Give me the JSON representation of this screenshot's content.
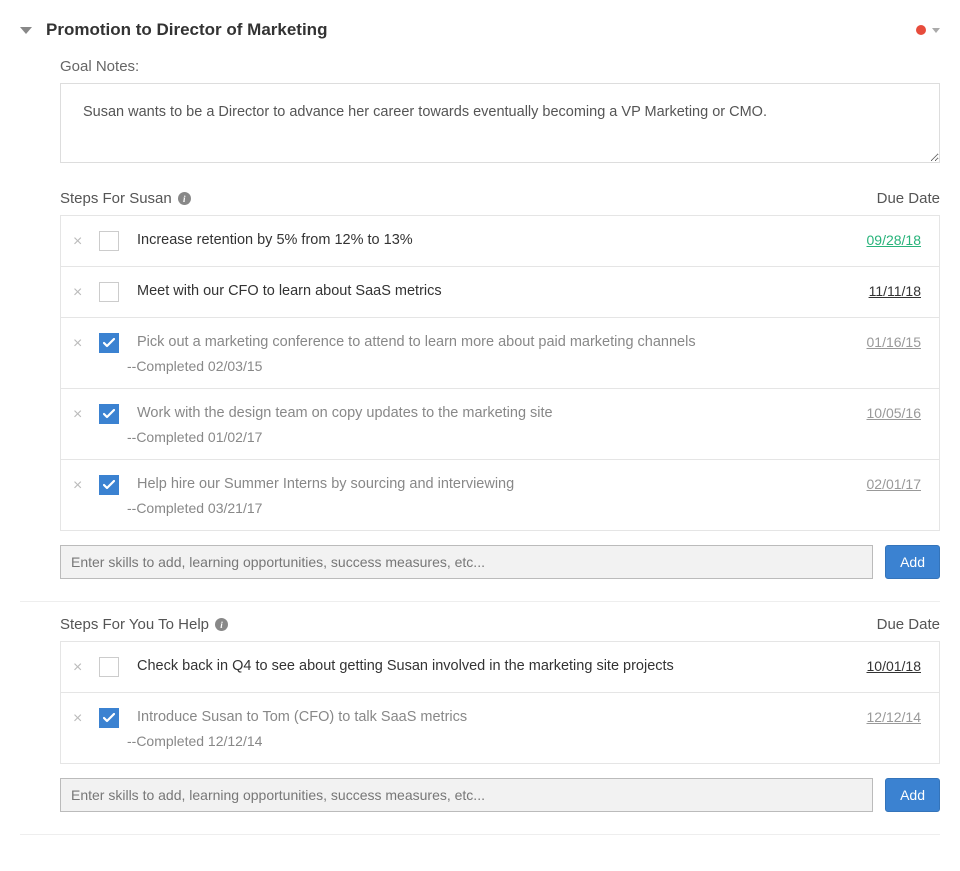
{
  "header": {
    "title": "Promotion to Director of Marketing",
    "status_color": "#e74c3c"
  },
  "goal": {
    "label": "Goal Notes:",
    "value": "Susan wants to be a Director to advance her career towards eventually becoming a VP Marketing or CMO."
  },
  "section_susan": {
    "title": "Steps For Susan",
    "due_label": "Due Date",
    "add_placeholder": "Enter skills to add, learning opportunities, success measures, etc...",
    "add_button": "Add",
    "steps": [
      {
        "text": "Increase retention by 5% from 12% to 13%",
        "due": "09/28/18",
        "overdue": true,
        "checked": false,
        "completed": ""
      },
      {
        "text": "Meet with our CFO to learn about SaaS metrics",
        "due": "11/11/18",
        "overdue": false,
        "checked": false,
        "completed": ""
      },
      {
        "text": "Pick out a marketing conference to attend to learn more about paid marketing channels",
        "due": "01/16/15",
        "overdue": false,
        "checked": true,
        "completed": "--Completed 02/03/15"
      },
      {
        "text": "Work with the design team on copy updates to the marketing site",
        "due": "10/05/16",
        "overdue": false,
        "checked": true,
        "completed": "--Completed 01/02/17"
      },
      {
        "text": "Help hire our Summer Interns by sourcing and interviewing",
        "due": "02/01/17",
        "overdue": false,
        "checked": true,
        "completed": "--Completed 03/21/17"
      }
    ]
  },
  "section_you": {
    "title": "Steps For You To Help",
    "due_label": "Due Date",
    "add_placeholder": "Enter skills to add, learning opportunities, success measures, etc...",
    "add_button": "Add",
    "steps": [
      {
        "text": "Check back in Q4 to see about getting Susan involved in the marketing site projects",
        "due": "10/01/18",
        "overdue": false,
        "checked": false,
        "completed": ""
      },
      {
        "text": "Introduce Susan to Tom (CFO) to talk SaaS metrics",
        "due": "12/12/14",
        "overdue": false,
        "checked": true,
        "completed": "--Completed 12/12/14"
      }
    ]
  },
  "glyphs": {
    "remove": "×"
  }
}
